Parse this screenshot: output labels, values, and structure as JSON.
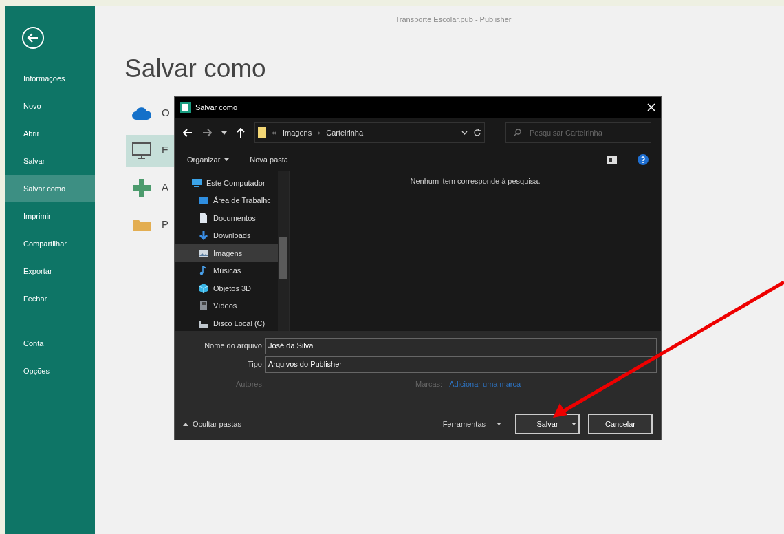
{
  "window": {
    "title": "Transporte Escolar.pub - Publisher"
  },
  "sidebar": {
    "items": [
      {
        "label": "Informações",
        "selected": false
      },
      {
        "label": "Novo",
        "selected": false
      },
      {
        "label": "Abrir",
        "selected": false
      },
      {
        "label": "Salvar",
        "selected": false
      },
      {
        "label": "Salvar como",
        "selected": true
      },
      {
        "label": "Imprimir",
        "selected": false
      },
      {
        "label": "Compartilhar",
        "selected": false
      },
      {
        "label": "Exportar",
        "selected": false
      },
      {
        "label": "Fechar",
        "selected": false
      }
    ],
    "footer_items": [
      {
        "label": "Conta",
        "selected": false
      },
      {
        "label": "Opções",
        "selected": false
      }
    ]
  },
  "page": {
    "title": "Salvar como",
    "locations": [
      {
        "kind": "cloud",
        "label": "O",
        "selected": false
      },
      {
        "kind": "computer",
        "label": "E",
        "selected": true
      },
      {
        "kind": "add",
        "label": "A",
        "selected": false
      },
      {
        "kind": "folder",
        "label": "P",
        "selected": false
      }
    ]
  },
  "dialog": {
    "title": "Salvar como",
    "path": [
      "Imagens",
      "Carteirinha"
    ],
    "search": {
      "placeholder": "Pesquisar Carteirinha"
    },
    "toolbar": [
      "Organizar",
      "Nova pasta"
    ],
    "nav": [
      {
        "kind": "computer",
        "label": "Este Computador",
        "selected": false,
        "children": [
          {
            "kind": "desktop",
            "label": "Área de Trabalhc",
            "selected": false
          },
          {
            "kind": "documents",
            "label": "Documentos",
            "selected": false
          },
          {
            "kind": "downloads",
            "label": "Downloads",
            "selected": false
          },
          {
            "kind": "pictures",
            "label": "Imagens",
            "selected": true
          },
          {
            "kind": "music",
            "label": "Músicas",
            "selected": false
          },
          {
            "kind": "objects",
            "label": "Objetos 3D",
            "selected": false
          },
          {
            "kind": "videos",
            "label": "Vídeos",
            "selected": false
          },
          {
            "kind": "drive",
            "label": "Disco Local (C)",
            "selected": false
          }
        ]
      }
    ],
    "empty_message": "Nenhum item corresponde à pesquisa.",
    "fields": [
      {
        "label": "Nome do arquivo:",
        "value": "José da Silva"
      },
      {
        "label": "Tipo:",
        "value": "Arquivos do Publisher"
      }
    ],
    "authors_label": "Autores:",
    "tags_label": "Marcas:",
    "tags_link": "Adicionar uma marca",
    "hide_folders": "Ocultar pastas",
    "tools": "Ferramentas",
    "buttons": [
      "Salvar",
      "Cancelar"
    ]
  }
}
